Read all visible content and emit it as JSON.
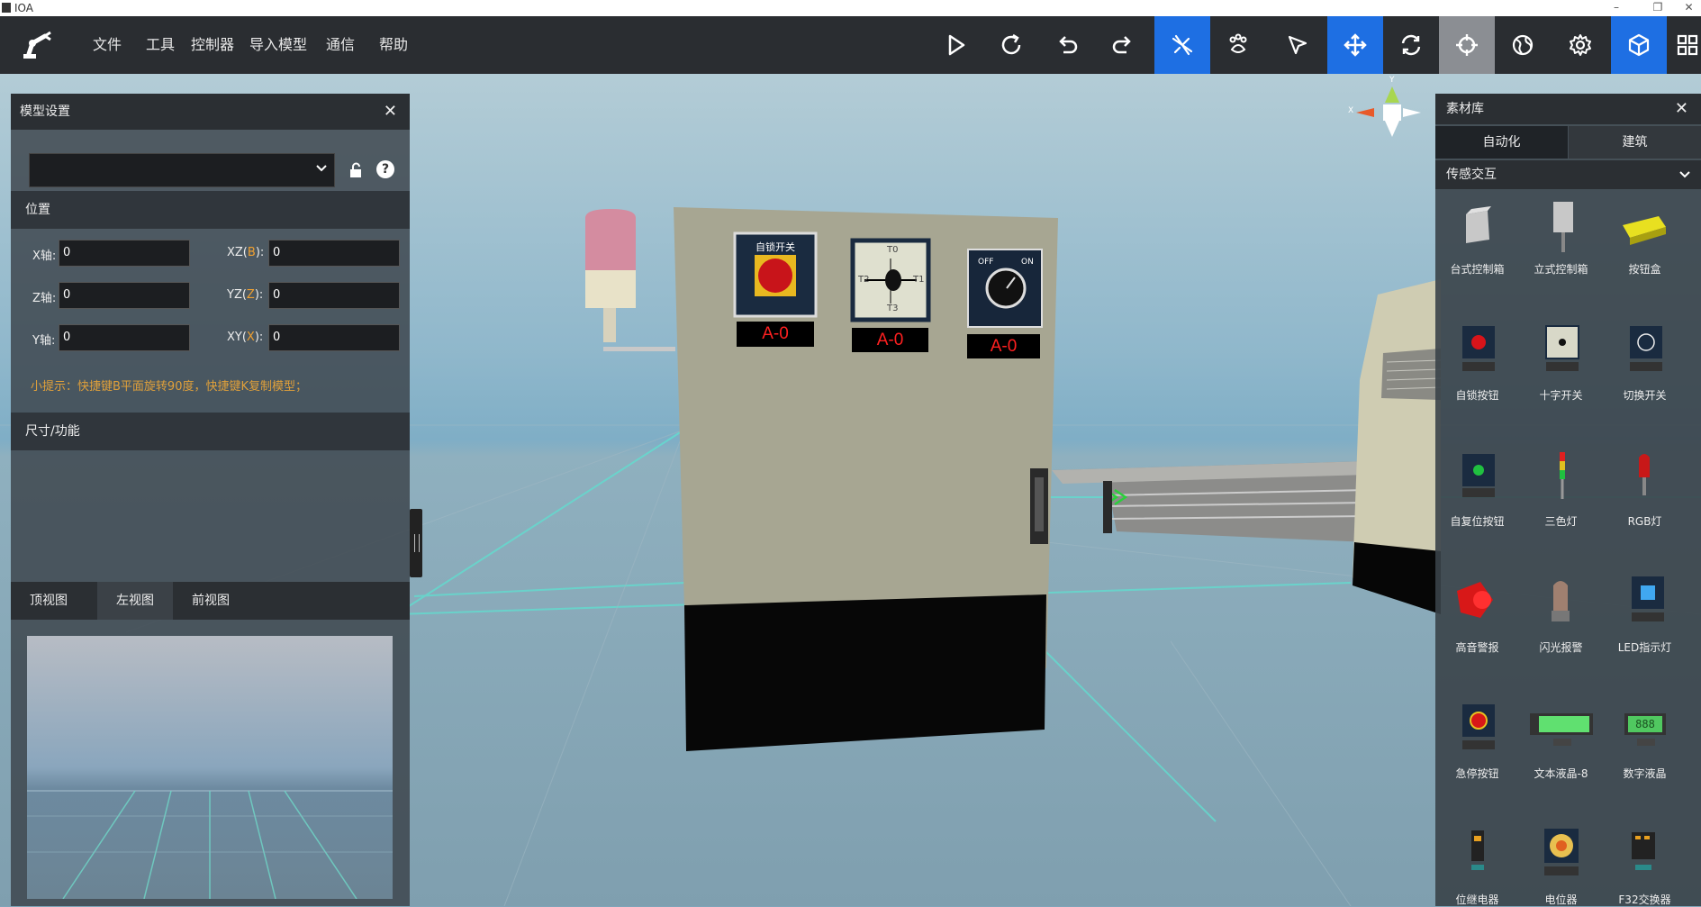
{
  "window": {
    "title": "IOA"
  },
  "menu": {
    "items": [
      "文件",
      "工具",
      "控制器",
      "导入模型",
      "通信",
      "帮助"
    ]
  },
  "toolbar": {
    "buttons": [
      "play-icon",
      "refresh-icon",
      "undo-icon",
      "redo-icon",
      "plane-icon",
      "paw-icon",
      "pointer-icon",
      "move-icon",
      "rotate-icon",
      "crosshair-icon",
      "globe-icon",
      "gear-icon",
      "cube-icon",
      "grid-icon"
    ]
  },
  "model_panel": {
    "title": "模型设置",
    "dropdown_value": "",
    "position_label": "位置",
    "fields": [
      {
        "label": "X轴:",
        "value": "0"
      },
      {
        "label": "Z轴:",
        "value": "0"
      },
      {
        "label": "Y轴:",
        "value": "0"
      }
    ],
    "rot_fields": [
      {
        "label_prefix": "XZ(",
        "key": "B",
        "label_suffix": "):",
        "value": "0"
      },
      {
        "label_prefix": "YZ(",
        "key": "Z",
        "label_suffix": "):",
        "value": "0"
      },
      {
        "label_prefix": "XY(",
        "key": "X",
        "label_suffix": "):",
        "value": "0"
      }
    ],
    "tip": "小提示：快捷键B平面旋转90度，快捷键K复制模型；",
    "size_label": "尺寸/功能",
    "view_tabs": [
      "顶视图",
      "左视图",
      "前视图"
    ],
    "selected_view": "左视图"
  },
  "scene": {
    "switch_label": "自锁开关",
    "rotary_ticks": [
      "T0",
      "T1",
      "T2",
      "T3"
    ],
    "off_label": "OFF",
    "on_label": "ON",
    "displays": [
      "A-0",
      "A-0",
      "A-0"
    ],
    "axis_labels": {
      "x": "X",
      "y": "Y"
    }
  },
  "library": {
    "title": "素材库",
    "tabs": [
      "自动化",
      "建筑"
    ],
    "active_tab": "自动化",
    "category": "传感交互",
    "items": [
      "台式控制箱",
      "立式控制箱",
      "按钮盒",
      "自锁按钮",
      "十字开关",
      "切换开关",
      "自复位按钮",
      "三色灯",
      "RGB灯",
      "高音警报",
      "闪光报警",
      "LED指示灯",
      "急停按钮",
      "文本液晶-8",
      "数字液晶",
      "位继电器",
      "电位器",
      "F32交换器"
    ],
    "lcd_text": "888"
  },
  "colors": {
    "accent": "#1e6fe3",
    "menubar": "#2a2d31",
    "tip": "#e0a03a",
    "display_red": "#ff2020"
  }
}
